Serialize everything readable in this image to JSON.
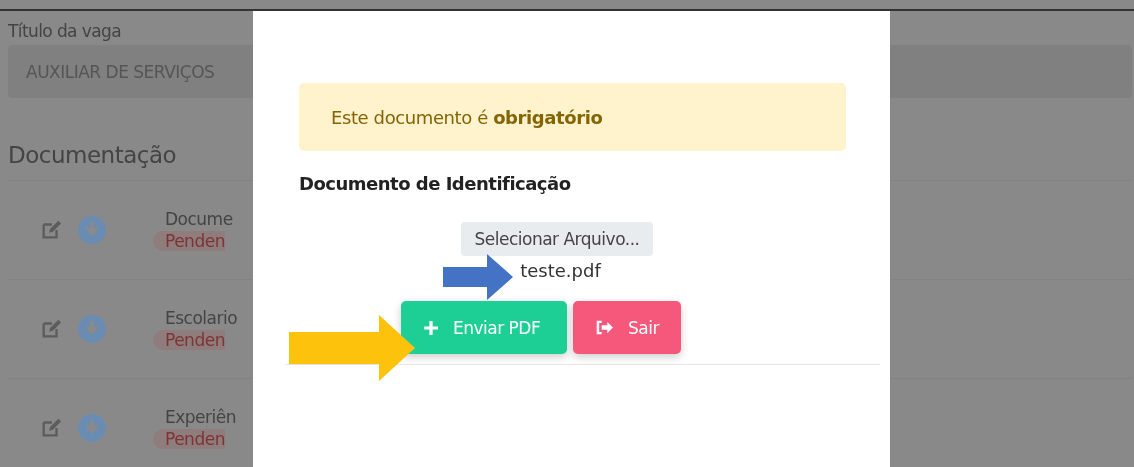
{
  "background_page": {
    "job_title_label": "Título da vaga",
    "job_title_value": "AUXILIAR DE SERVIÇOS",
    "section_title": "Documentação",
    "documents": [
      {
        "name": "Docume",
        "status": "Penden"
      },
      {
        "name": "Escolario",
        "status": "Penden"
      },
      {
        "name": "Experiên",
        "status": "Penden"
      }
    ]
  },
  "modal": {
    "alert": "Este documento é **obrigatório**",
    "document_title": "Documento de Identificação",
    "file_button": "Selecionar Arquivo...",
    "file_name": "teste.pdf",
    "buttons": [
      {
        "label": "Enviar PDF",
        "kind": "submit"
      },
      {
        "label": "Sair",
        "kind": "exit"
      }
    ]
  }
}
